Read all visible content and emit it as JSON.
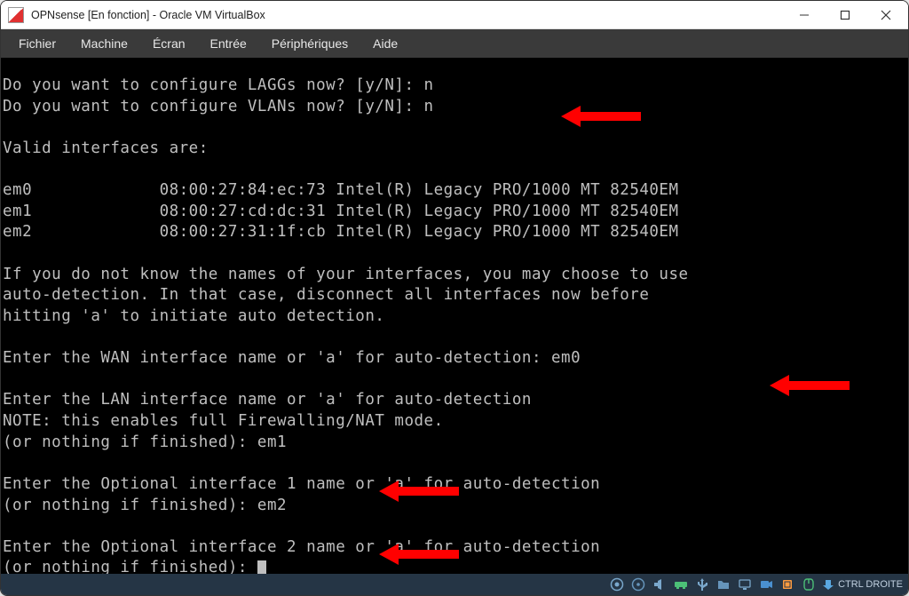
{
  "window": {
    "title": "OPNsense [En fonction] - Oracle VM VirtualBox"
  },
  "menu": {
    "items": [
      "Fichier",
      "Machine",
      "Écran",
      "Entrée",
      "Périphériques",
      "Aide"
    ]
  },
  "terminal": {
    "line_laggs": "Do you want to configure LAGGs now? [y/N]: n",
    "line_vlans": "Do you want to configure VLANs now? [y/N]: n",
    "line_valid": "Valid interfaces are:",
    "interfaces": [
      {
        "name": "em0",
        "mac": "08:00:27:84:ec:73",
        "desc": "Intel(R) Legacy PRO/1000 MT 82540EM"
      },
      {
        "name": "em1",
        "mac": "08:00:27:cd:dc:31",
        "desc": "Intel(R) Legacy PRO/1000 MT 82540EM"
      },
      {
        "name": "em2",
        "mac": "08:00:27:31:1f:cb",
        "desc": "Intel(R) Legacy PRO/1000 MT 82540EM"
      }
    ],
    "info1": "If you do not know the names of your interfaces, you may choose to use",
    "info2": "auto-detection. In that case, disconnect all interfaces now before",
    "info3": "hitting 'a' to initiate auto detection.",
    "wan_prompt": "Enter the WAN interface name or 'a' for auto-detection: em0",
    "lan_prompt1": "Enter the LAN interface name or 'a' for auto-detection",
    "lan_note": "NOTE: this enables full Firewalling/NAT mode.",
    "lan_prompt2": "(or nothing if finished): em1",
    "opt1_prompt1": "Enter the Optional interface 1 name or 'a' for auto-detection",
    "opt1_prompt2": "(or nothing if finished): em2",
    "opt2_prompt1": "Enter the Optional interface 2 name or 'a' for auto-detection",
    "opt2_prompt2": "(or nothing if finished): "
  },
  "statusbar": {
    "host_key": "CTRL DROITE"
  }
}
